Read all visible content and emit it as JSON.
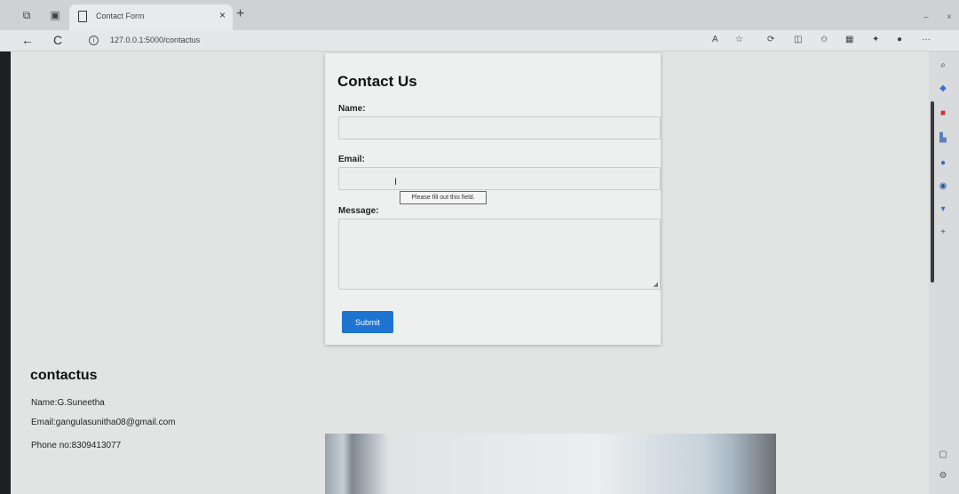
{
  "browser": {
    "tab_title": "Contact Form",
    "tab_close": "×",
    "new_tab": "+",
    "url": "127.0.0.1:5000/contactus",
    "back": "←",
    "reload": "C",
    "info": "i",
    "read_aloud": "A",
    "more": "···",
    "minimize": "–",
    "close": "×"
  },
  "form": {
    "title": "Contact Us",
    "name_label": "Name:",
    "email_label": "Email:",
    "message_label": "Message:",
    "name_value": "",
    "email_value": "",
    "message_value": "",
    "validation_tooltip": "Please fill out this field.",
    "submit_label": "Submit"
  },
  "contact_info": {
    "heading": "contactus",
    "name_line": "Name:G.Suneetha",
    "email_line": "Email:gangulasunitha08@gmail.com",
    "phone_line": "Phone no:8309413077"
  },
  "colors": {
    "submit_bg": "#1e74d0",
    "page_bg": "#e2e4e3"
  }
}
